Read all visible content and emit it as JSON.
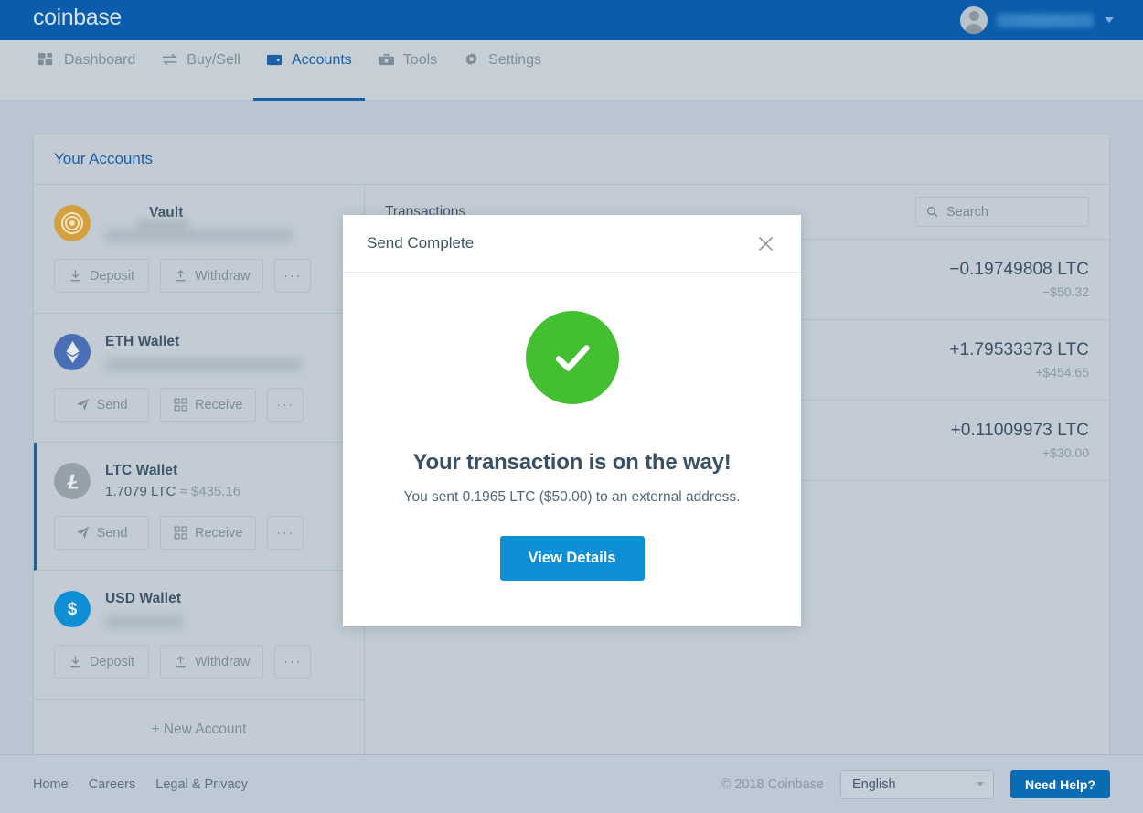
{
  "header": {
    "brand": "coinbase",
    "avatar_icon": "user-avatar-icon",
    "caret_icon": "chevron-down-icon"
  },
  "nav": {
    "items": [
      {
        "label": "Dashboard",
        "icon": "dashboard-grid-icon",
        "active": false
      },
      {
        "label": "Buy/Sell",
        "icon": "exchange-arrows-icon",
        "active": false
      },
      {
        "label": "Accounts",
        "icon": "wallet-icon",
        "active": true
      },
      {
        "label": "Tools",
        "icon": "toolbox-icon",
        "active": false
      },
      {
        "label": "Settings",
        "icon": "gear-icon",
        "active": false
      }
    ]
  },
  "accounts_card": {
    "title": "Your Accounts",
    "new_account_label": "+ New Account",
    "items": [
      {
        "name": "Vault",
        "icon": "vault-dial-icon",
        "balance": "",
        "balance_hidden": true,
        "name_hidden": true,
        "selected": false,
        "actions": [
          {
            "label": "Deposit",
            "icon": "download-arrow-icon"
          },
          {
            "label": "Withdraw",
            "icon": "upload-arrow-icon"
          },
          {
            "label": "···",
            "icon": "more-dots-icon"
          }
        ]
      },
      {
        "name": "ETH Wallet",
        "icon": "ethereum-icon",
        "balance": "",
        "balance_hidden": true,
        "name_hidden": false,
        "selected": false,
        "actions": [
          {
            "label": "Send",
            "icon": "paper-plane-icon"
          },
          {
            "label": "Receive",
            "icon": "qr-code-icon"
          },
          {
            "label": "···",
            "icon": "more-dots-icon"
          }
        ]
      },
      {
        "name": "LTC Wallet",
        "icon": "litecoin-icon",
        "balance": "1.7079 LTC",
        "balance_fiat": "≈ $435.16",
        "balance_hidden": false,
        "name_hidden": false,
        "selected": true,
        "actions": [
          {
            "label": "Send",
            "icon": "paper-plane-icon"
          },
          {
            "label": "Receive",
            "icon": "qr-code-icon"
          },
          {
            "label": "···",
            "icon": "more-dots-icon"
          }
        ]
      },
      {
        "name": "USD Wallet",
        "icon": "dollar-icon",
        "balance": "",
        "balance_hidden": true,
        "name_hidden": false,
        "selected": false,
        "actions": [
          {
            "label": "Deposit",
            "icon": "download-arrow-icon"
          },
          {
            "label": "Withdraw",
            "icon": "upload-arrow-icon"
          },
          {
            "label": "···",
            "icon": "more-dots-icon"
          }
        ]
      }
    ]
  },
  "transactions": {
    "title": "Transactions",
    "search": {
      "placeholder": "Search",
      "value": "",
      "icon": "search-icon"
    },
    "rows": [
      {
        "crypto": "−0.19749808 LTC",
        "fiat": "−$50.32"
      },
      {
        "crypto": "+1.79533373 LTC",
        "fiat": "+$454.65"
      },
      {
        "crypto": "+0.11009973 LTC",
        "fiat": "+$30.00"
      }
    ]
  },
  "modal": {
    "title": "Send Complete",
    "close_icon": "close-x-icon",
    "status_icon": "check-circle-icon",
    "heading": "Your transaction is on the way!",
    "message": "You sent 0.1965 LTC ($50.00) to an external address.",
    "primary_button": "View Details"
  },
  "footer": {
    "links": [
      "Home",
      "Careers",
      "Legal & Privacy"
    ],
    "copyright": "© 2018 Coinbase",
    "language": "English",
    "language_caret_icon": "chevron-down-icon",
    "help_button": "Need Help?"
  },
  "colors": {
    "brand_blue": "#0b5cab",
    "accent_blue": "#1a5fa8",
    "button_blue": "#0d8fd8",
    "success_green": "#43bf31",
    "page_bg": "#b9c6d2",
    "nav_bg": "#c6cfd6"
  }
}
